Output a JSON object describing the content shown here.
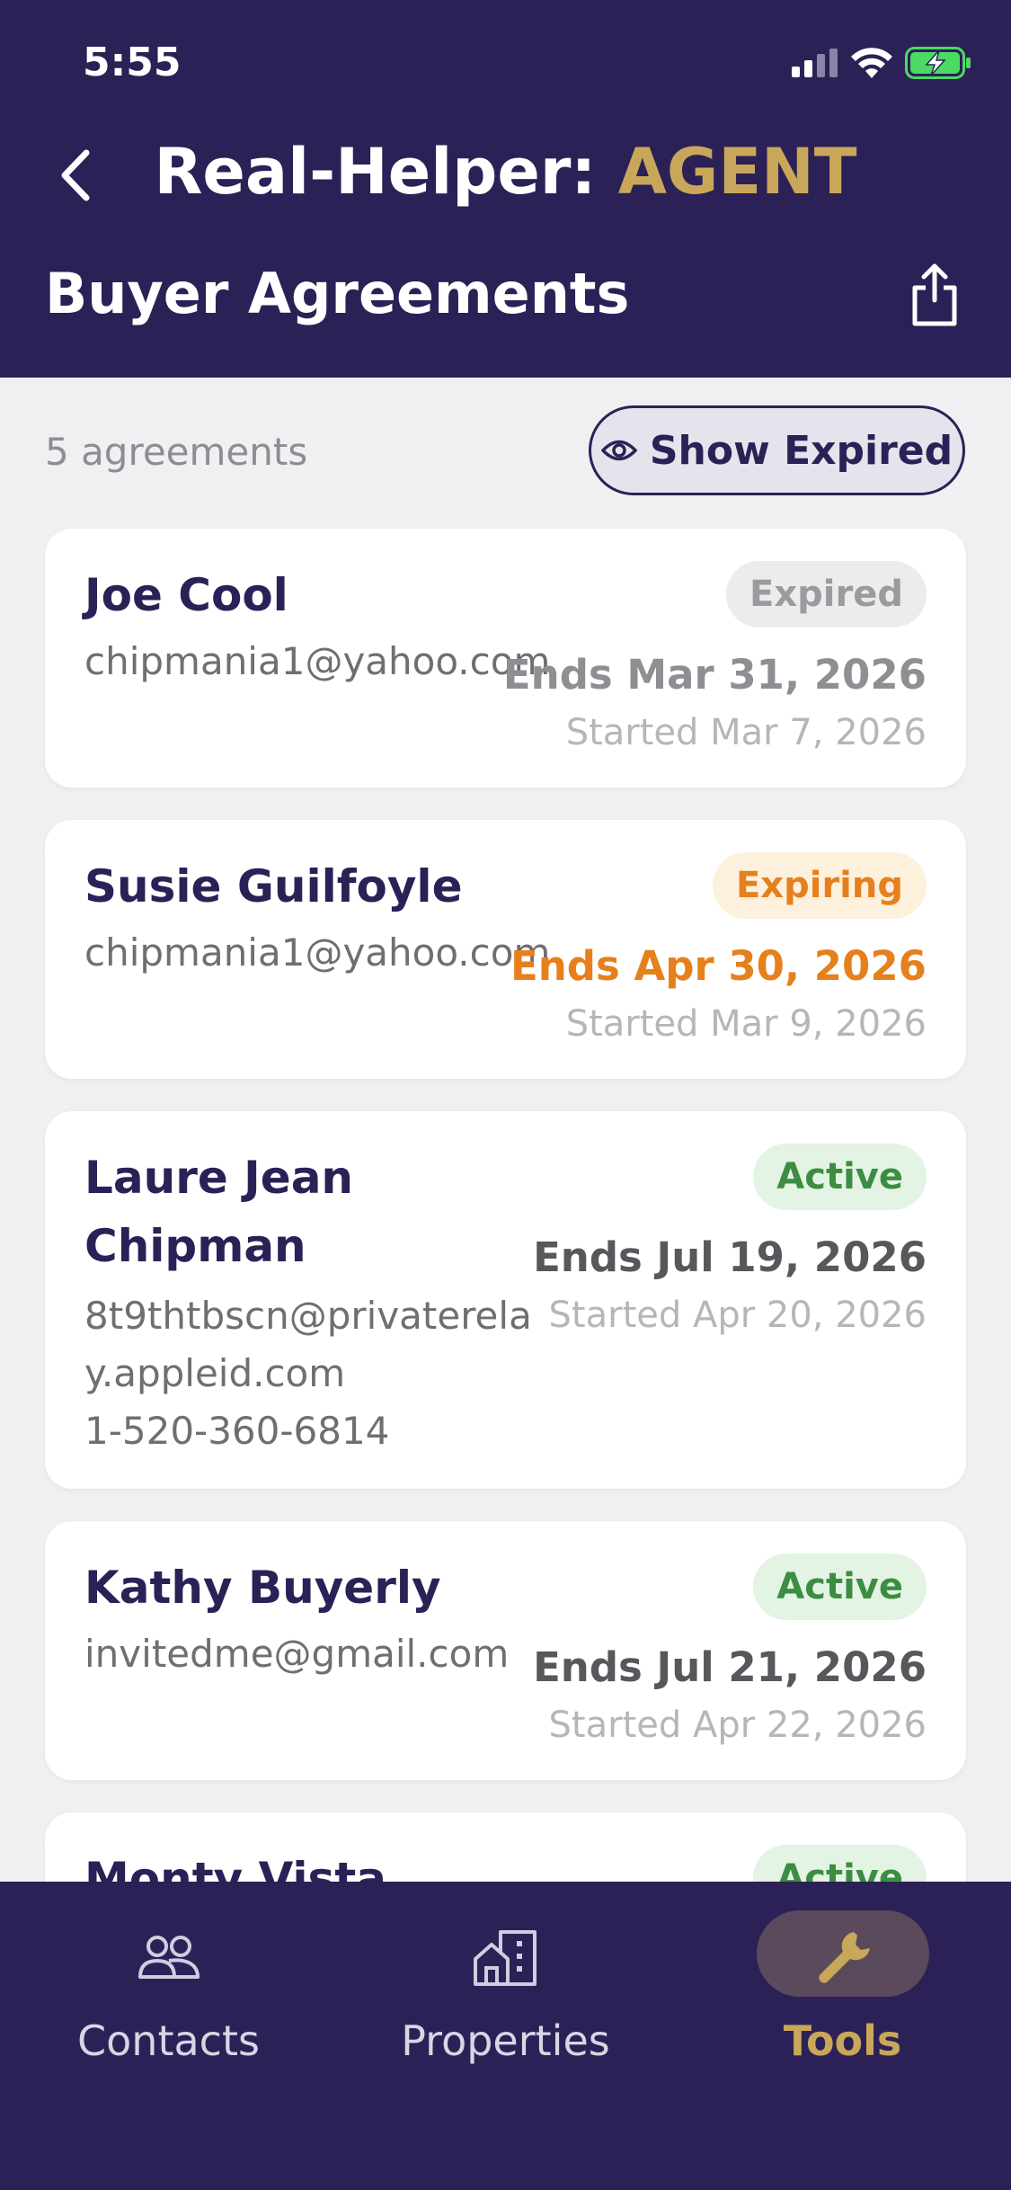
{
  "status_bar": {
    "time": "5:55"
  },
  "header": {
    "title_prefix": "Real-Helper: ",
    "title_accent": "AGENT",
    "page_title": "Buyer Agreements"
  },
  "toolbar": {
    "count_label": "5 agreements",
    "show_expired_label": "Show Expired"
  },
  "agreements": [
    {
      "name": "Joe Cool",
      "contact": [
        "chipmania1@yahoo.com"
      ],
      "status": "Expired",
      "ends": "Ends Mar 31, 2026",
      "started": "Started Mar 7, 2026"
    },
    {
      "name": "Susie Guilfoyle",
      "contact": [
        "chipmania1@yahoo.com"
      ],
      "status": "Expiring",
      "ends": "Ends Apr 30, 2026",
      "started": "Started Mar 9, 2026"
    },
    {
      "name": "Laure Jean Chipman",
      "contact": [
        "8t9thtbscn@privaterelay.appleid.com",
        "1-520-360-6814"
      ],
      "status": "Active",
      "ends": "Ends Jul 19, 2026",
      "started": "Started Apr 20, 2026"
    },
    {
      "name": "Kathy Buyerly",
      "contact": [
        "invitedme@gmail.com"
      ],
      "status": "Active",
      "ends": "Ends Jul 21, 2026",
      "started": "Started Apr 22, 2026"
    },
    {
      "name": "Monty Vista",
      "contact": [],
      "status": "Active",
      "ends": "",
      "started": ""
    }
  ],
  "tabs": [
    {
      "label": "Contacts",
      "icon": "people-icon"
    },
    {
      "label": "Properties",
      "icon": "buildings-icon"
    },
    {
      "label": "Tools",
      "icon": "wrench-icon",
      "active": true
    }
  ],
  "colors": {
    "header_bg": "#2c2156",
    "accent_gold": "#c9a75a",
    "expiring_orange": "#e6801d",
    "active_green": "#3c8d42"
  }
}
